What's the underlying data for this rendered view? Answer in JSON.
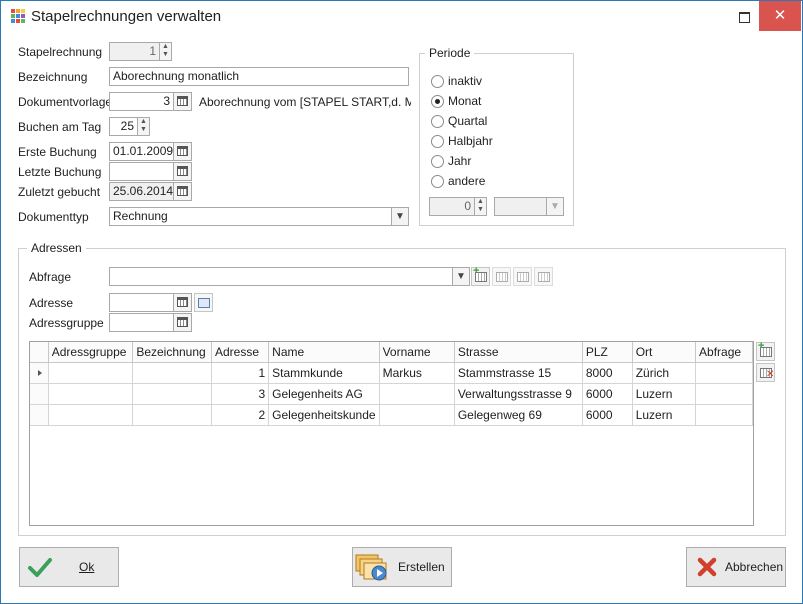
{
  "window": {
    "title": "Stapelrechnungen verwalten",
    "close_glyph": "✕"
  },
  "icons": {
    "app": "grid-icon",
    "maximize": "maximize-icon",
    "close": "close-icon"
  },
  "colors": {
    "accent": "#2b78b5",
    "close": "#d9534f",
    "ok_check": "#3aa05a",
    "cancel_x": "#d0402c"
  },
  "form": {
    "stapelrechnung": {
      "label": "Stapelrechnung",
      "value": "1"
    },
    "bezeichnung": {
      "label": "Bezeichnung",
      "value": "Aborechnung monatlich"
    },
    "dokumentvorlage": {
      "label": "Dokumentvorlage",
      "value": "3",
      "description": "Aborechnung vom [STAPEL START,d. MM..."
    },
    "buchen_am_tag": {
      "label": "Buchen am Tag",
      "value": "25"
    },
    "erste_buchung": {
      "label": "Erste Buchung",
      "value": "01.01.2009"
    },
    "letzte_buchung": {
      "label": "Letzte Buchung",
      "value": ""
    },
    "zuletzt_gebucht": {
      "label": "Zuletzt gebucht",
      "value": "25.06.2014"
    },
    "dokumenttyp": {
      "label": "Dokumenttyp",
      "value": "Rechnung"
    }
  },
  "periode": {
    "title": "Periode",
    "options": [
      "inaktiv",
      "Monat",
      "Quartal",
      "Halbjahr",
      "Jahr",
      "andere"
    ],
    "selected_index": 1,
    "count_value": "0",
    "unit_value": ""
  },
  "adressen": {
    "title": "Adressen",
    "abfrage": {
      "label": "Abfrage",
      "value": ""
    },
    "adresse": {
      "label": "Adresse",
      "value": ""
    },
    "adressgruppe": {
      "label": "Adressgruppe",
      "value": ""
    },
    "columns": [
      "Adressgruppe",
      "Bezeichnung",
      "Adresse",
      "Name",
      "Vorname",
      "Strasse",
      "PLZ",
      "Ort",
      "Abfrage"
    ],
    "rows": [
      {
        "adressgruppe": "",
        "bezeichnung": "",
        "adresse": "1",
        "name": "Stammkunde",
        "vorname": "Markus",
        "strasse": "Stammstrasse 15",
        "plz": "8000",
        "ort": "Zürich",
        "abfrage": ""
      },
      {
        "adressgruppe": "",
        "bezeichnung": "",
        "adresse": "3",
        "name": "Gelegenheits AG",
        "vorname": "",
        "strasse": "Verwaltungsstrasse 9",
        "plz": "6000",
        "ort": "Luzern",
        "abfrage": ""
      },
      {
        "adressgruppe": "",
        "bezeichnung": "",
        "adresse": "2",
        "name": "Gelegenheitskunde",
        "vorname": "",
        "strasse": "Gelegenweg 69",
        "plz": "6000",
        "ort": "Luzern",
        "abfrage": ""
      }
    ]
  },
  "buttons": {
    "ok": "Ok",
    "erstellen": "Erstellen",
    "abbrechen": "Abbrechen"
  }
}
